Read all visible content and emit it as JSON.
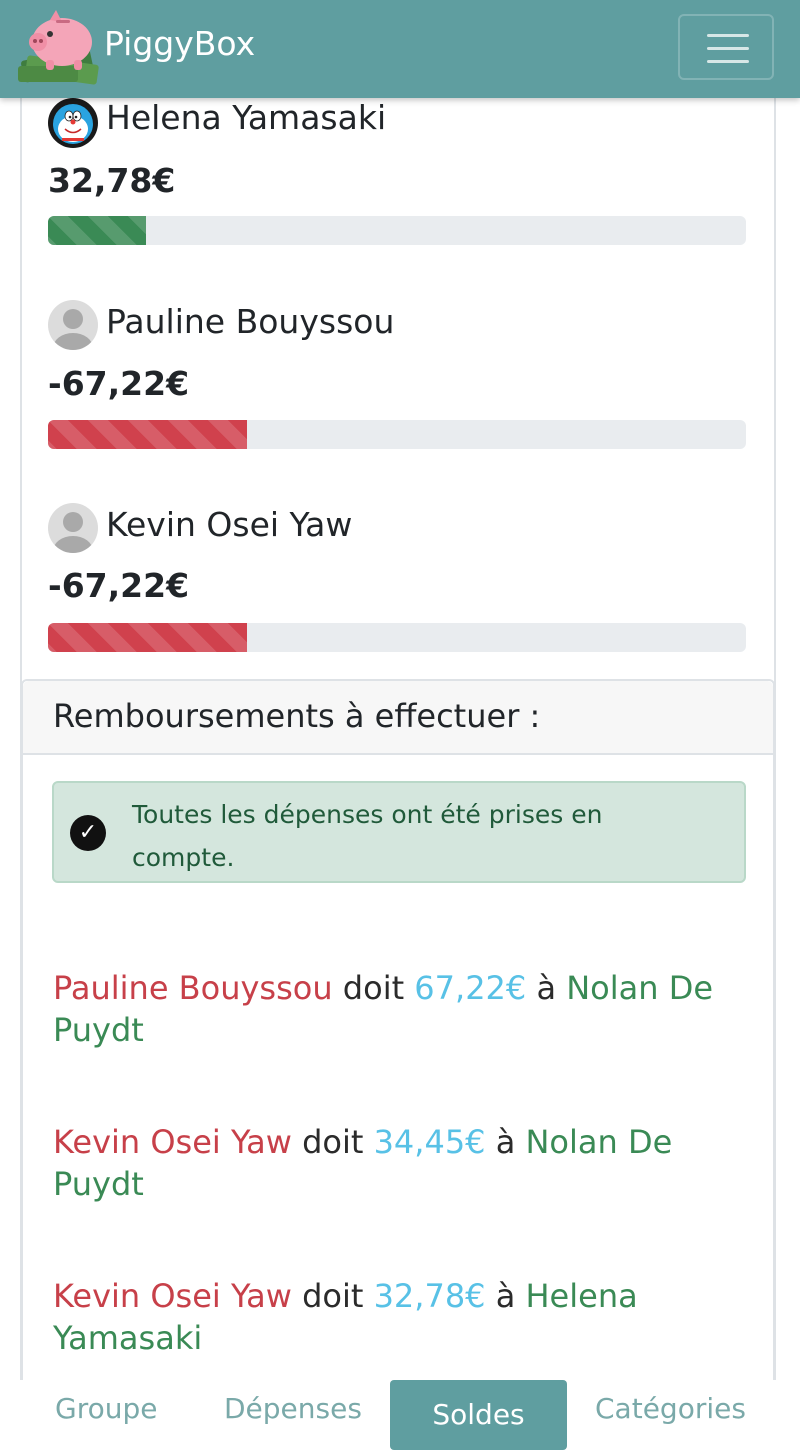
{
  "navbar": {
    "brand": "PiggyBox",
    "logo_icon": "piggy-bank-money-icon",
    "menu_icon": "hamburger-menu-icon",
    "color": "#5f9ea0"
  },
  "balances": [
    {
      "name": "Helena Yamasaki",
      "amount": "32,78€",
      "status": "positive",
      "progress_fraction": 0.14,
      "avatar": "doraemon-avatar-icon"
    },
    {
      "name": "Pauline Bouyssou",
      "amount": "-67,22€",
      "status": "negative",
      "progress_fraction": 0.285,
      "avatar": "default-user-avatar-icon"
    },
    {
      "name": "Kevin Osei Yaw",
      "amount": "-67,22€",
      "status": "negative",
      "progress_fraction": 0.285,
      "avatar": "default-user-avatar-icon"
    }
  ],
  "reimbursements": {
    "title": "Remboursements à effectuer :",
    "alert_text": "Toutes les dépenses ont été prises en compte.",
    "items": [
      {
        "debtor": "Pauline Bouyssou",
        "verb": "doit",
        "amount": "67,22€",
        "to": "à",
        "creditor": "Nolan De Puydt"
      },
      {
        "debtor": "Kevin Osei Yaw",
        "verb": "doit",
        "amount": "34,45€",
        "to": "à",
        "creditor": "Nolan De Puydt"
      },
      {
        "debtor": "Kevin Osei Yaw",
        "verb": "doit",
        "amount": "32,78€",
        "to": "à",
        "creditor": "Helena Yamasaki"
      }
    ]
  },
  "tabs": [
    {
      "label": "Groupe",
      "active": false
    },
    {
      "label": "Dépenses",
      "active": false
    },
    {
      "label": "Soldes",
      "active": true
    },
    {
      "label": "Catégories",
      "active": false
    }
  ],
  "colors": {
    "positive": "#3a8a55",
    "negative": "#d0414d",
    "amount_highlight": "#58c1e6",
    "alert_bg": "#d4e6dd"
  }
}
